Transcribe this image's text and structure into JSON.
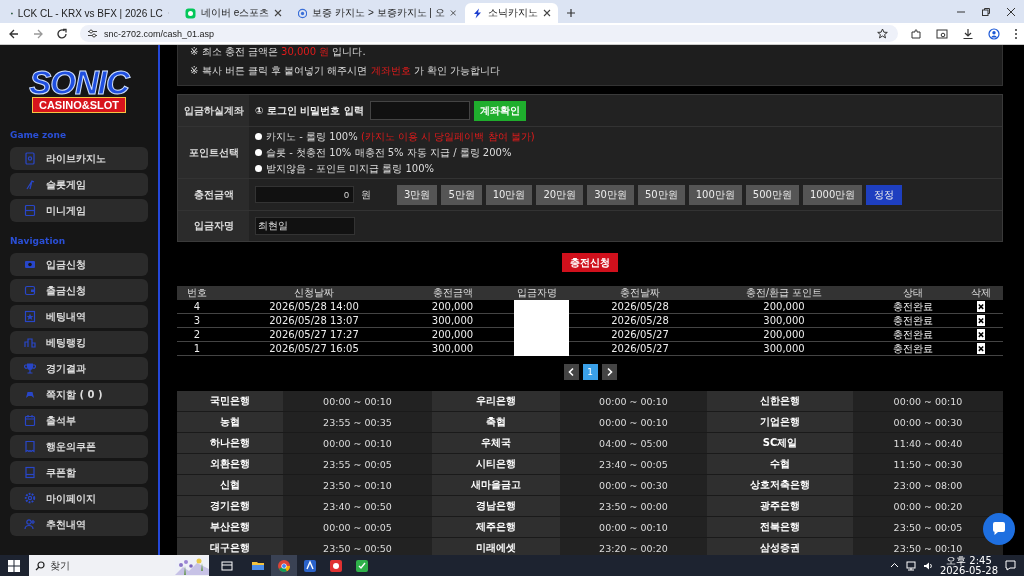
{
  "browser": {
    "tabs": [
      {
        "title": "LCK CL - KRX vs BFX | 2026 LC",
        "kind": "lck",
        "selected": false
      },
      {
        "title": "네이버 e스포츠",
        "kind": "naver",
        "selected": false
      },
      {
        "title": "보증 카지노 > 보증카지노 | 오",
        "kind": "oc",
        "selected": false
      },
      {
        "title": "소닉카지노",
        "kind": "sonic",
        "selected": true
      }
    ],
    "address": "snc-2702.com/cash_01.asp"
  },
  "sidebar": {
    "logo": {
      "title": "SONIC",
      "subtitle": "CASINO&SLOT"
    },
    "sections": [
      {
        "heading": "Game zone",
        "items": [
          {
            "label": "라이브카지노"
          },
          {
            "label": "슬롯게임"
          },
          {
            "label": "미니게임"
          }
        ]
      },
      {
        "heading": "Navigation",
        "items": [
          {
            "label": "입금신청"
          },
          {
            "label": "출금신청"
          },
          {
            "label": "베팅내역"
          },
          {
            "label": "베팅랭킹"
          },
          {
            "label": "경기결과"
          },
          {
            "label": "쪽지함 ( 0 )"
          },
          {
            "label": "출석부"
          },
          {
            "label": "행운의쿠폰"
          },
          {
            "label": "쿠폰함"
          },
          {
            "label": "마이페이지"
          },
          {
            "label": "추천내역"
          }
        ]
      }
    ]
  },
  "notices": [
    {
      "segments": [
        {
          "text": "※ 최소 충전 금액은 ",
          "highlight": false
        },
        {
          "text": "30,000 원",
          "highlight": true
        },
        {
          "text": " 입니다.",
          "highlight": false
        }
      ]
    },
    {
      "segments": [
        {
          "text": "※ 복사 버튼 클릭 후 붙여넣기 해주시면 ",
          "highlight": false
        },
        {
          "text": "계좌번호",
          "highlight": true
        },
        {
          "text": " 가 확인 가능합니다",
          "highlight": false
        }
      ]
    }
  ],
  "deposit_form": [
    {
      "kind": "account",
      "label": "입금하실계좌",
      "prompt": "① 로그인 비밀번호 입력",
      "button": "계좌확인"
    },
    {
      "kind": "points",
      "label": "포인트선택",
      "options": [
        {
          "text": "카지노 - 롤링 100% ",
          "note": "(카지노 이용 시 당일페이백 참여 불가)",
          "selected": false
        },
        {
          "text": "슬롯 - 첫충전 10% 매충전 5% 자동 지급 / 롤링 200%",
          "selected": false
        },
        {
          "text": "받지않음 - 포인트 미지급 롤링 100%",
          "selected": false
        }
      ]
    },
    {
      "kind": "amount",
      "label": "충전금액",
      "value": "0",
      "unit": "원",
      "buttons": [
        {
          "label": "3만원",
          "kind": "preset"
        },
        {
          "label": "5만원",
          "kind": "preset"
        },
        {
          "label": "10만원",
          "kind": "preset"
        },
        {
          "label": "20만원",
          "kind": "preset"
        },
        {
          "label": "30만원",
          "kind": "preset"
        },
        {
          "label": "50만원",
          "kind": "preset"
        },
        {
          "label": "100만원",
          "kind": "preset"
        },
        {
          "label": "500만원",
          "kind": "preset"
        },
        {
          "label": "1000만원",
          "kind": "preset"
        },
        {
          "label": "정정",
          "kind": "reset"
        }
      ]
    },
    {
      "kind": "name",
      "label": "입금자명",
      "value": "최현일"
    }
  ],
  "submit_button": "충전신청",
  "history": {
    "columns": [
      "번호",
      "신청날짜",
      "충전금액",
      "입금자명",
      "충전날짜",
      "충전/환급 포인트",
      "상태",
      "삭제"
    ],
    "redacted": true,
    "rows": [
      {
        "no": "4",
        "requested": "2026/05/28 14:00",
        "amount": "200,000",
        "charged": "2026/05/28",
        "points": "200,000",
        "status": "충전완료"
      },
      {
        "no": "3",
        "requested": "2026/05/28 13:07",
        "amount": "300,000",
        "charged": "2026/05/28",
        "points": "300,000",
        "status": "충전완료"
      },
      {
        "no": "2",
        "requested": "2026/05/27 17:27",
        "amount": "200,000",
        "charged": "2026/05/27",
        "points": "200,000",
        "status": "충전완료"
      },
      {
        "no": "1",
        "requested": "2026/05/27 16:05",
        "amount": "300,000",
        "charged": "2026/05/27",
        "points": "300,000",
        "status": "충전완료"
      }
    ]
  },
  "pagination": {
    "pages": [
      {
        "label": "1",
        "selected": true
      }
    ]
  },
  "bank_hours": [
    [
      {
        "bank": "국민은행",
        "hours": "00:00 ~ 00:10"
      },
      {
        "bank": "우리은행",
        "hours": "00:00 ~ 00:10"
      },
      {
        "bank": "신한은행",
        "hours": "00:00 ~ 00:10"
      }
    ],
    [
      {
        "bank": "농협",
        "hours": "23:55 ~ 00:35"
      },
      {
        "bank": "축협",
        "hours": "00:00 ~ 00:10"
      },
      {
        "bank": "기업은행",
        "hours": "00:00 ~ 00:30"
      }
    ],
    [
      {
        "bank": "하나은행",
        "hours": "00:00 ~ 00:10"
      },
      {
        "bank": "우체국",
        "hours": "04:00 ~ 05:00"
      },
      {
        "bank": "SC제일",
        "hours": "11:40 ~ 00:40"
      }
    ],
    [
      {
        "bank": "외환은행",
        "hours": "23:55 ~ 00:05"
      },
      {
        "bank": "시티은행",
        "hours": "23:40 ~ 00:05"
      },
      {
        "bank": "수협",
        "hours": "11:50 ~ 00:30"
      }
    ],
    [
      {
        "bank": "신협",
        "hours": "23:50 ~ 00:10"
      },
      {
        "bank": "새마을금고",
        "hours": "00:00 ~ 00:30"
      },
      {
        "bank": "상호저축은행",
        "hours": "23:00 ~ 08:00"
      }
    ],
    [
      {
        "bank": "경기은행",
        "hours": "23:40 ~ 00:50"
      },
      {
        "bank": "경남은행",
        "hours": "23:50 ~ 00:00"
      },
      {
        "bank": "광주은행",
        "hours": "00:00 ~ 00:20"
      }
    ],
    [
      {
        "bank": "부산은행",
        "hours": "00:00 ~ 00:05"
      },
      {
        "bank": "제주은행",
        "hours": "00:00 ~ 00:10"
      },
      {
        "bank": "전북은행",
        "hours": "23:50 ~ 00:05"
      }
    ],
    [
      {
        "bank": "대구은행",
        "hours": "23:50 ~ 00:50"
      },
      {
        "bank": "미래에셋",
        "hours": "23:20 ~ 00:20"
      },
      {
        "bank": "삼성증권",
        "hours": "23:50 ~ 00:10"
      }
    ]
  ],
  "taskbar": {
    "search_placeholder": "찾기",
    "apps": [
      {
        "kind": "explorer",
        "selected": false
      },
      {
        "kind": "chrome",
        "selected": true
      },
      {
        "kind": "blue",
        "selected": false
      },
      {
        "kind": "red",
        "selected": false
      },
      {
        "kind": "green",
        "selected": false
      }
    ],
    "time": "오후 2:45",
    "date": "2026-05-28"
  }
}
